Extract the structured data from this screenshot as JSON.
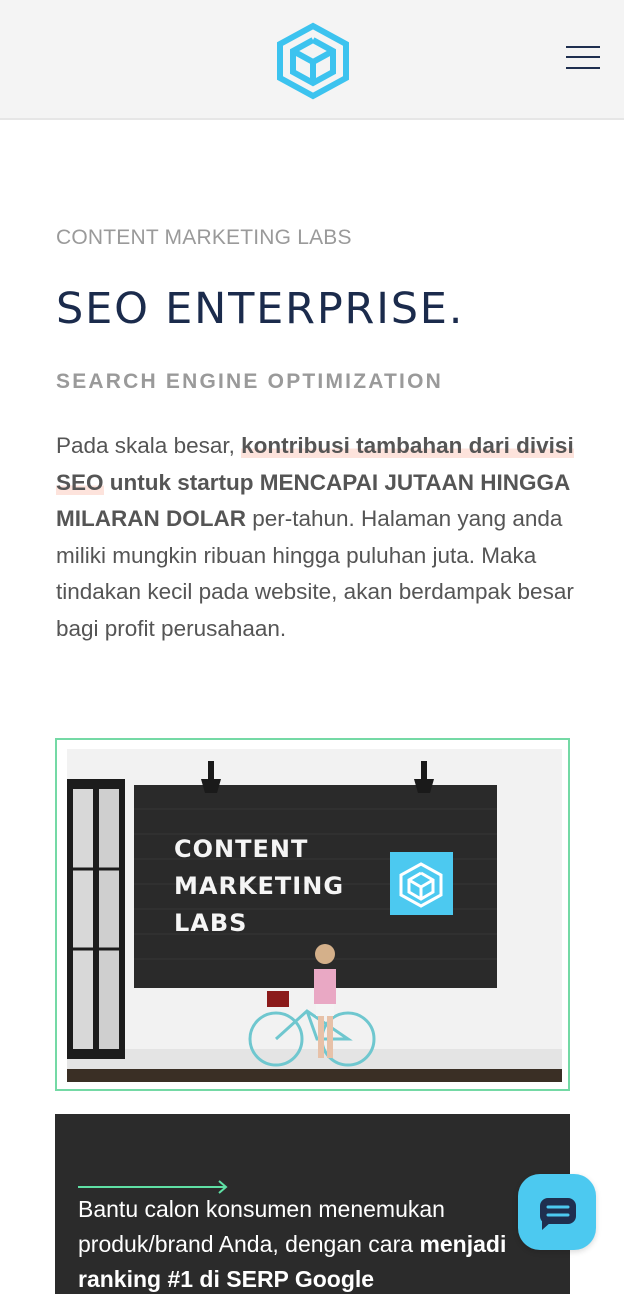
{
  "header": {
    "logo_icon": "cml-cube-logo-icon",
    "menu_icon": "hamburger-menu-icon",
    "brand_color": "#3cc3ef"
  },
  "hero": {
    "eyebrow": "CONTENT MARKETING LABS",
    "title": "SEO ENTERPRISE.",
    "subtitle": "SEARCH ENGINE OPTIMIZATION",
    "paragraph": {
      "p1": "Pada skala besar, ",
      "p2": "kontribusi tambahan dari divisi SEO",
      "p3": " untuk startup MENCAPAI JUTAAN HINGGA MILARAN DOLAR",
      "p4": " per-tahun. Halaman yang anda miliki mungkin ribuan hingga puluhan juta. Maka tindakan kecil pada website, akan berdampak besar bagi profit perusahaan."
    }
  },
  "image": {
    "sign_line1": "CONTENT",
    "sign_line2": "MARKETING",
    "sign_line3": "LABS",
    "frame_color": "#74d9a5"
  },
  "dark_block": {
    "text1": "Bantu calon konsumen menemukan produk/brand Anda, dengan cara ",
    "text2": "menjadi ranking #1 di SERP Google",
    "arrow_color": "#5fe0a5"
  },
  "chat": {
    "icon": "chat-bubble-icon",
    "color": "#4cc9f0"
  }
}
